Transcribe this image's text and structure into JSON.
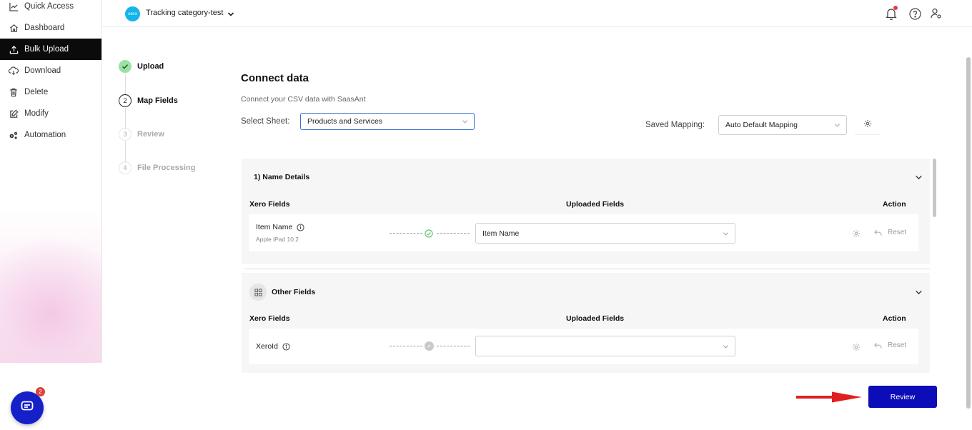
{
  "sidebar": {
    "items": [
      {
        "label": "Quick Access",
        "icon": "chart-line-icon"
      },
      {
        "label": "Dashboard",
        "icon": "home-icon"
      },
      {
        "label": "Bulk Upload",
        "icon": "upload-icon"
      },
      {
        "label": "Download",
        "icon": "cloud-download-icon"
      },
      {
        "label": "Delete",
        "icon": "trash-icon"
      },
      {
        "label": "Modify",
        "icon": "edit-icon"
      },
      {
        "label": "Automation",
        "icon": "gears-icon"
      }
    ],
    "active_index": 2
  },
  "header": {
    "logo_text": "xero",
    "org_name": "Tracking category-test"
  },
  "steps": [
    {
      "num": "",
      "label": "Upload",
      "state": "done"
    },
    {
      "num": "2",
      "label": "Map Fields",
      "state": "current"
    },
    {
      "num": "3",
      "label": "Review",
      "state": "pending"
    },
    {
      "num": "4",
      "label": "File Processing",
      "state": "pending"
    }
  ],
  "main": {
    "title": "Connect data",
    "subtitle": "Connect your CSV data with SaasAnt",
    "select_sheet_label": "Select Sheet:",
    "select_sheet_value": "Products and Services",
    "saved_mapping_label": "Saved Mapping:",
    "saved_mapping_value": "Auto Default Mapping"
  },
  "sections": [
    {
      "title": "1) Name Details",
      "col_xero": "Xero Fields",
      "col_uploaded": "Uploaded Fields",
      "col_action": "Action",
      "field": "Item Name",
      "field_sample": "Apple iPad 10.2",
      "mapped_value": "Item Name",
      "reset_label": "Reset"
    },
    {
      "title": "Other Fields",
      "col_xero": "Xero Fields",
      "col_uploaded": "Uploaded Fields",
      "col_action": "Action",
      "field": "XeroId",
      "mapped_value": "",
      "reset_label": "Reset"
    }
  ],
  "footer": {
    "review_label": "Review",
    "chat_badge": "2"
  },
  "colors": {
    "primary": "#0c0cb8",
    "active_sidebar": "#0b0b0b",
    "success": "#5cc66e",
    "xero_blue": "#13b5ea",
    "arrow_red": "#e02020"
  }
}
